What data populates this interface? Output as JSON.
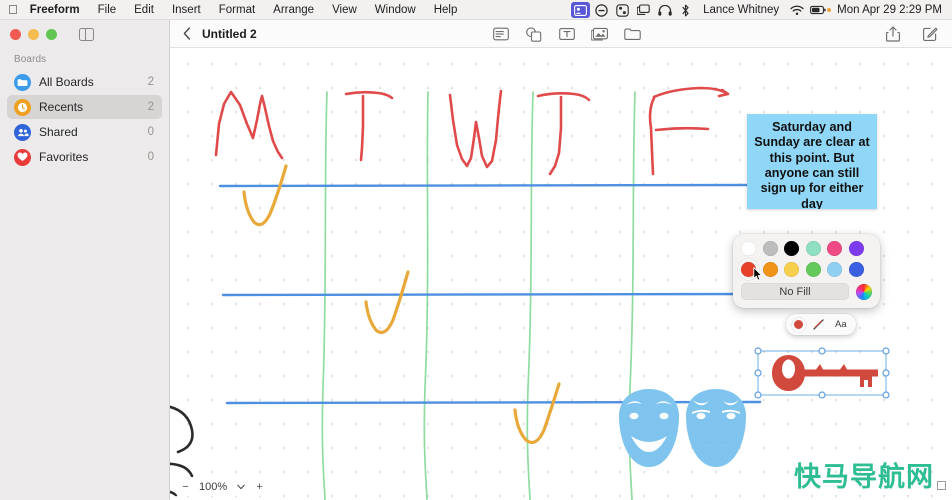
{
  "menubar": {
    "apple_icon": "apple-logo-icon",
    "app_name": "Freeform",
    "items": [
      "File",
      "Edit",
      "Insert",
      "Format",
      "Arrange",
      "View",
      "Window",
      "Help"
    ],
    "status_icons": [
      "screen-sharing-icon",
      "do-not-disturb-icon",
      "control-center-icon",
      "display-mirror-icon",
      "headphones-icon",
      "bluetooth-icon"
    ],
    "user": "Lance Whitney",
    "wifi_icon": "wifi-icon",
    "battery_icon": "battery-icon",
    "clock": "Mon Apr 29  2:29 PM"
  },
  "window": {
    "traffic_lights": [
      "close-button",
      "minimize-button",
      "zoom-button"
    ],
    "sidebar_toggle_icon": "sidebar-toggle-icon"
  },
  "sidebar": {
    "header": "Boards",
    "items": [
      {
        "label": "All Boards",
        "count": "2",
        "icon": "folder-icon",
        "selected": false
      },
      {
        "label": "Recents",
        "count": "2",
        "icon": "clock-icon",
        "selected": true
      },
      {
        "label": "Shared",
        "count": "0",
        "icon": "people-icon",
        "selected": false
      },
      {
        "label": "Favorites",
        "count": "0",
        "icon": "heart-icon",
        "selected": false
      }
    ]
  },
  "toolbar": {
    "back_icon": "back-chevron-icon",
    "title": "Untitled 2",
    "center_icons": [
      "sticky-note-icon",
      "shapes-icon",
      "text-box-icon",
      "media-icon",
      "insert-file-icon"
    ],
    "right_icons": [
      "share-icon",
      "compose-icon"
    ]
  },
  "canvas": {
    "sticky_note": {
      "text": "Saturday and Sunday are clear at this point. But anyone can still sign up for either day",
      "fill": "#8fd6f7"
    },
    "annotations": {
      "letters": [
        "M",
        "T",
        "W",
        "T",
        "F"
      ],
      "letter_color": "#e04a4a",
      "divider_color": "#4d8fe0",
      "column_line_color": "#8fdba0",
      "check_color": "#e8a93a"
    },
    "shapes": [
      {
        "name": "theater-masks-shape",
        "color": "#7ec4ef"
      },
      {
        "name": "key-shape",
        "color": "#d1483c",
        "selected": true
      }
    ]
  },
  "color_popup": {
    "row1": [
      {
        "name": "white",
        "hex": "#ffffff",
        "selected": false
      },
      {
        "name": "gray",
        "hex": "#bdbdbd",
        "selected": false
      },
      {
        "name": "black",
        "hex": "#000000",
        "selected": false
      },
      {
        "name": "mint",
        "hex": "#8fe0c2",
        "selected": false
      },
      {
        "name": "pink",
        "hex": "#ef4a86",
        "selected": false
      },
      {
        "name": "purple",
        "hex": "#7d3bf0",
        "selected": false
      }
    ],
    "row2": [
      {
        "name": "red",
        "hex": "#e8412a",
        "selected": true
      },
      {
        "name": "orange",
        "hex": "#f09418",
        "selected": false
      },
      {
        "name": "yellow",
        "hex": "#f7d14e",
        "selected": false
      },
      {
        "name": "green",
        "hex": "#63c95a",
        "selected": false
      },
      {
        "name": "light-blue",
        "hex": "#8fd0f2",
        "selected": false
      },
      {
        "name": "blue",
        "hex": "#3a5fe0",
        "selected": false
      }
    ],
    "no_fill_label": "No Fill",
    "color_wheel_icon": "color-wheel-icon",
    "cursor_icon": "pointer-cursor-icon"
  },
  "mini_toolbar": {
    "fill_swatch": {
      "name": "red",
      "hex": "#d1483c"
    },
    "stroke_icon": "no-stroke-icon",
    "text_icon": "Aa"
  },
  "zoom_control": {
    "minus_label": "−",
    "value": "100%",
    "chevron_icon": "chevron-down-icon",
    "plus_label": "+"
  },
  "watermark": {
    "text": "快马导航网",
    "color": "#2fbd93"
  }
}
